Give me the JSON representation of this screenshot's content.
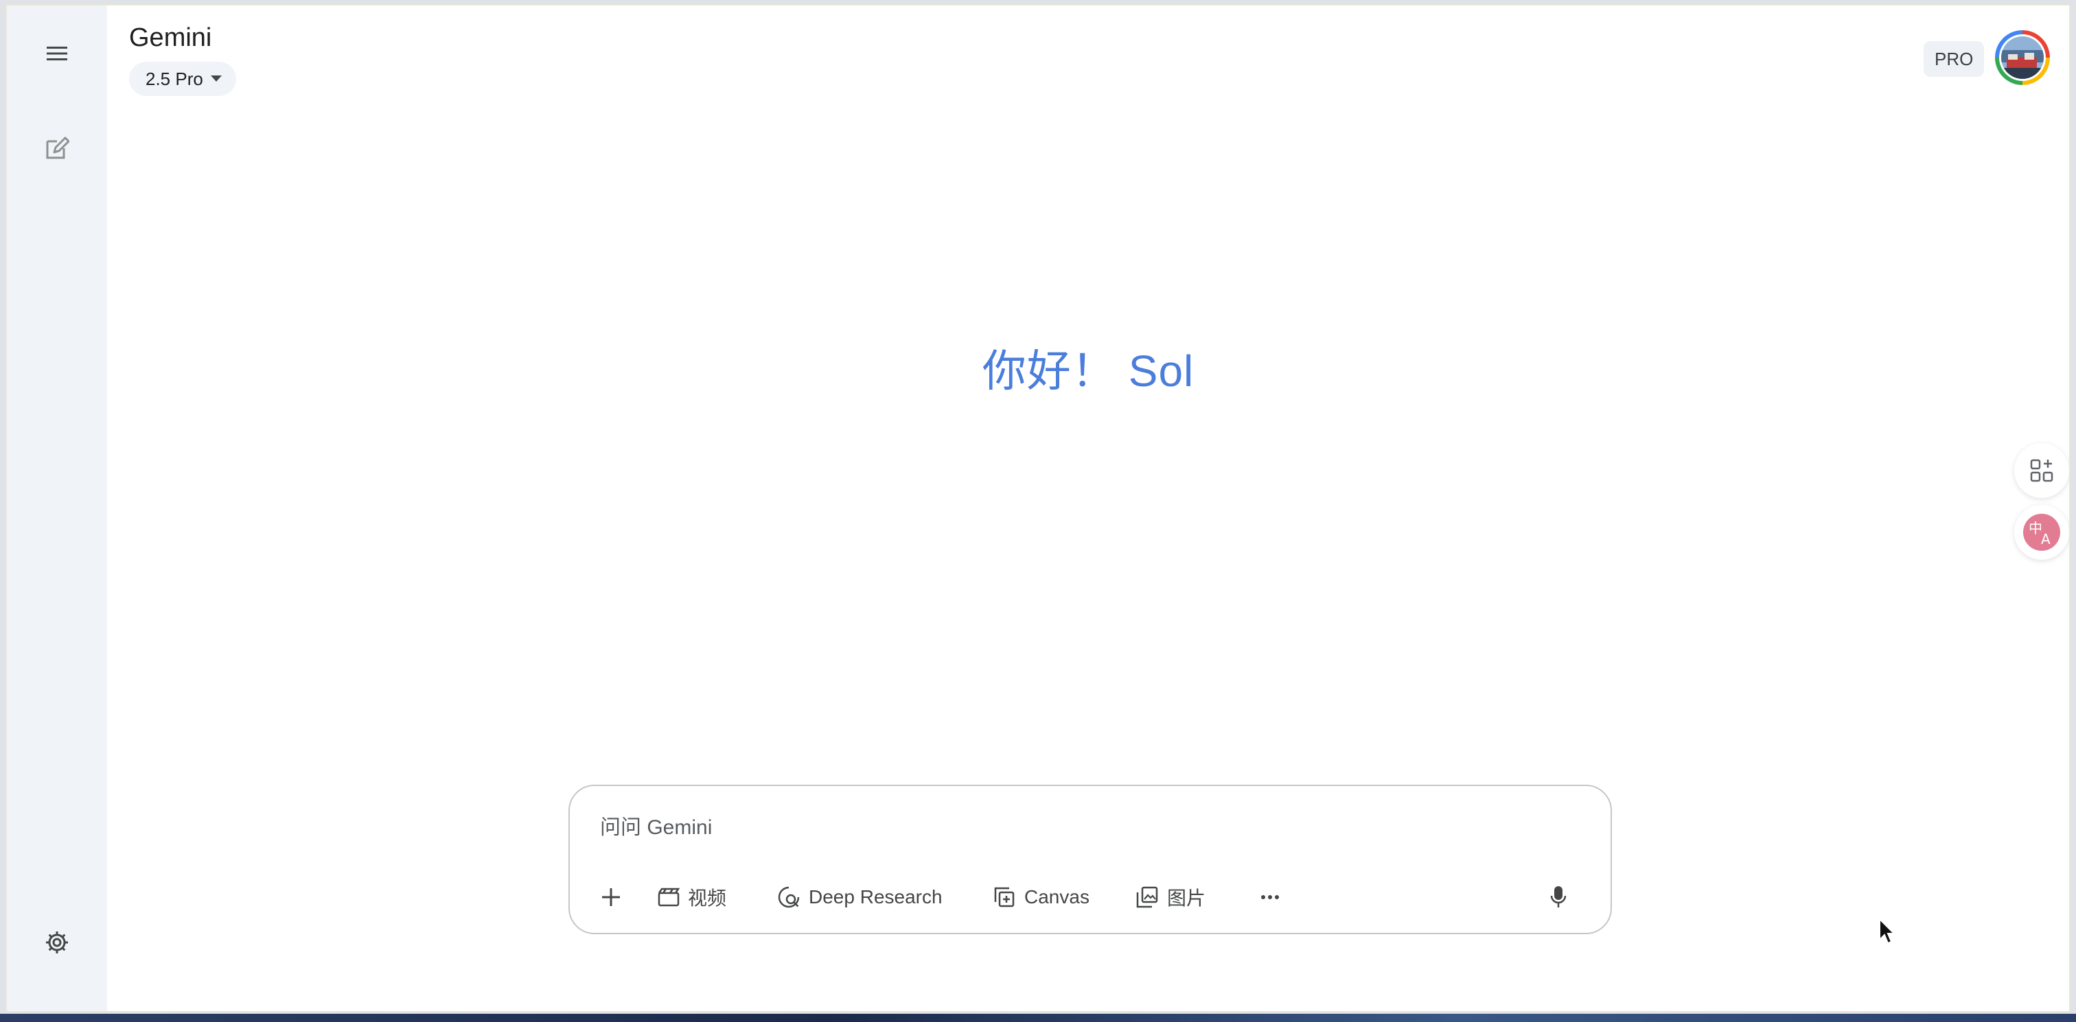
{
  "app": {
    "title": "Gemini",
    "model_label": "2.5 Pro",
    "plan_badge": "PRO"
  },
  "sidebar": {
    "menu_icon": "menu-icon",
    "new_chat_icon": "edit-icon",
    "settings_icon": "settings-gear-icon"
  },
  "greeting": {
    "hello": "你好！",
    "name": "Sol"
  },
  "composer": {
    "placeholder": "问问 Gemini",
    "tools": [
      {
        "label": "视频",
        "icon": "video-clapper-icon"
      },
      {
        "label": "Deep Research",
        "icon": "deep-research-icon"
      },
      {
        "label": "Canvas",
        "icon": "canvas-icon"
      },
      {
        "label": "图片",
        "icon": "image-gallery-icon"
      }
    ]
  },
  "floating": {
    "apps_icon": "apps-sparkle-icon",
    "translate_icon": "translate-icon"
  },
  "colors": {
    "greeting_blue": "#4a7ddc",
    "sidebar_bg": "#f0f4f9"
  }
}
